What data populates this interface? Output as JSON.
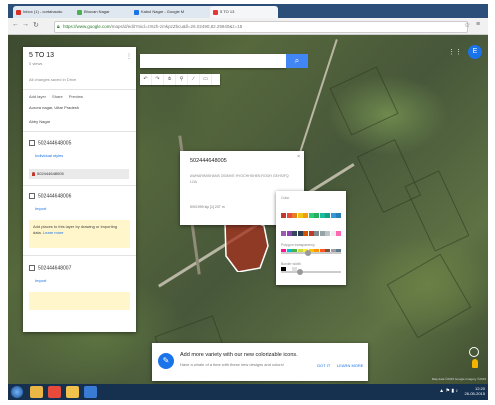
{
  "browser": {
    "tabs": [
      {
        "label": "Inbox (1) - cortahaudu",
        "color": "#d93025"
      },
      {
        "label": "Bhuvan Nagar",
        "color": "#4caf50"
      },
      {
        "label": "Kabul Nagar - Google M",
        "color": "#1a73e8"
      },
      {
        "label": "5 TO 13",
        "color": "#e53935"
      }
    ],
    "url_host": "https://www.google.com",
    "url_rest": "/maps/d/edit?mid=zr6zh-zmkpzZbcu&ll=26.02490,82.29940&z=15"
  },
  "panel": {
    "title": "5 TO 13",
    "subtitle": "0 views",
    "saved": "All changes saved in Drive",
    "actions": [
      "Add layer",
      "Share",
      "Preview"
    ],
    "base_row": "Aurora nagar, Uttar Pradesh",
    "base_sub": "Abby Nagar",
    "layers": [
      {
        "title": "502444648005",
        "style_link": "Individual styles",
        "feature": "502444648005"
      },
      {
        "title": "502444648006",
        "import_link": "Import"
      },
      {
        "title": "502444648007",
        "import_link": "Import"
      }
    ],
    "hint": "Add places to this layer by drawing or importing data.",
    "learn_more": "Learn more"
  },
  "toolbar": {
    "icons": [
      "undo-icon",
      "redo-icon",
      "hand-icon",
      "marker-icon",
      "line-icon",
      "ruler-icon"
    ]
  },
  "info_window": {
    "title": "502444648005",
    "description": "AWHARIMISHANS OIDMVE HYOCHHSHEN ROOH GEHSIFQ LOA",
    "footer": "5/9/1999 kip  [1] 207 m"
  },
  "color_picker": {
    "color_label": "Color",
    "opacity_label": "Polygon transparency",
    "border_label": "Border width",
    "colors": [
      "#c0392b",
      "#e74c3c",
      "#e67e22",
      "#f1c40f",
      "#f39c12",
      "#2ecc71",
      "#27ae60",
      "#1abc9c",
      "#16a085",
      "#3498db",
      "#2980b9",
      "#9b59b6",
      "#8e44ad",
      "#34495e",
      "#2c3e50",
      "#d35400",
      "#c0392b",
      "#7f8c8d",
      "#95a5a6",
      "#bdc3c7",
      "#ecf0f1",
      "#ff69b4",
      "#ff1493",
      "#00bcd4",
      "#4caf50",
      "#cddc39",
      "#ffeb3b",
      "#ffc107",
      "#ff9800",
      "#ff5722",
      "#795548",
      "#9e9e9e",
      "#607d8b",
      "#000000",
      "#ffffff",
      "#e0e0e0"
    ],
    "opacity": 0.45,
    "border": 0.3
  },
  "notification": {
    "headline": "Add more variety with our new colorizable icons.",
    "body": "Have a whale of a time with these new designs and colors!",
    "got_it": "GOT IT",
    "learn_more": "LEARN MORE"
  },
  "taskbar": {
    "apps": [
      {
        "name": "explorer-app",
        "color": "#e8b746"
      },
      {
        "name": "chrome-app",
        "color": "#e84b3c"
      },
      {
        "name": "folder-app",
        "color": "#f0c14b"
      },
      {
        "name": "media-app",
        "color": "#3a7bd5"
      }
    ],
    "time": "12:20",
    "date": "26-05-2015"
  },
  "map": {
    "attribution": "Map data ©2015 Google Imagery ©2015"
  },
  "user_initial": "E"
}
